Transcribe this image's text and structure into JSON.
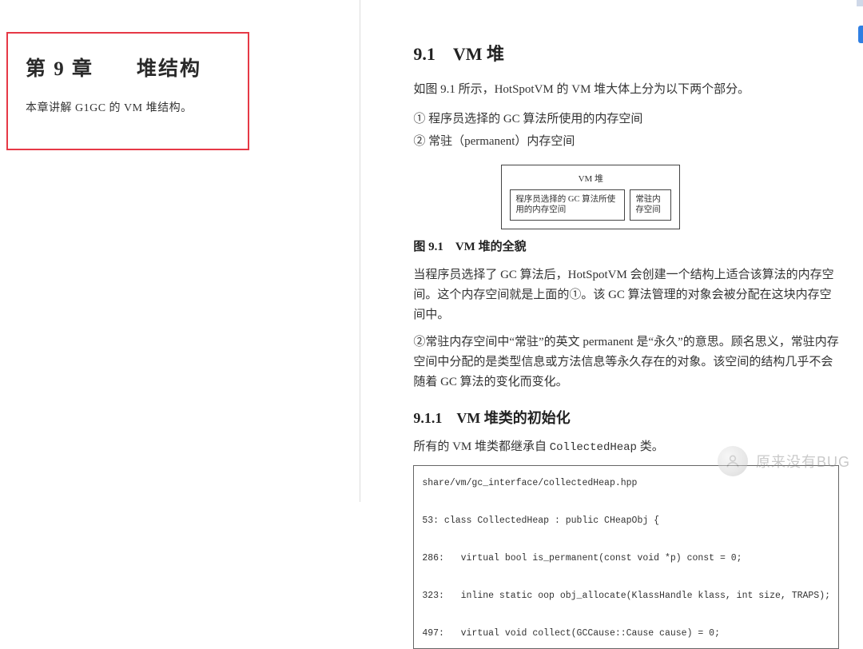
{
  "left": {
    "chapter_prefix": "第 ",
    "chapter_number": "9",
    "chapter_suffix": " 章",
    "chapter_spacer": "　　",
    "chapter_name": "堆结构",
    "intro": "本章讲解 G1GC 的 VM 堆结构。"
  },
  "right": {
    "section_number": "9.1",
    "section_spacer": "　",
    "section_title": "VM 堆",
    "p1": "如图 9.1 所示，HotSpotVM 的 VM 堆大体上分为以下两个部分。",
    "li1": "① 程序员选择的 GC 算法所使用的内存空间",
    "li2": "② 常驻（permanent）内存空间",
    "figure": {
      "inner_title": "VM 堆",
      "cell_big": "程序员选择的 GC 算法所使用的内存空间",
      "cell_small": "常驻内存空间",
      "caption_prefix": "图 ",
      "caption_number": "9.1",
      "caption_spacer": "　",
      "caption_text": "VM 堆的全貌"
    },
    "p2": "当程序员选择了 GC 算法后，HotSpotVM 会创建一个结构上适合该算法的内存空间。这个内存空间就是上面的①。该 GC 算法管理的对象会被分配在这块内存空间中。",
    "p3": "②常驻内存空间中“常驻”的英文 permanent 是“永久”的意思。顾名思义，常驻内存空间中分配的是类型信息或方法信息等永久存在的对象。该空间的结构几乎不会随着 GC 算法的变化而变化。",
    "subsection_number": "9.1.1",
    "subsection_spacer": "　",
    "subsection_title": "VM 堆类的初始化",
    "p4_pre": "所有的 VM 堆类都继承自 ",
    "p4_code": "CollectedHeap",
    "p4_post": " 类。",
    "code": {
      "path": "share/vm/gc_interface/collectedHeap.hpp",
      "l1": "53: class CollectedHeap : public CHeapObj {",
      "l2": "286:   virtual bool is_permanent(const void *p) const = 0;",
      "l3": "323:   inline static oop obj_allocate(KlassHandle klass, int size, TRAPS);",
      "l4": "497:   virtual void collect(GCCause::Cause cause) = 0;"
    }
  },
  "watermark": "原来没有BUG"
}
